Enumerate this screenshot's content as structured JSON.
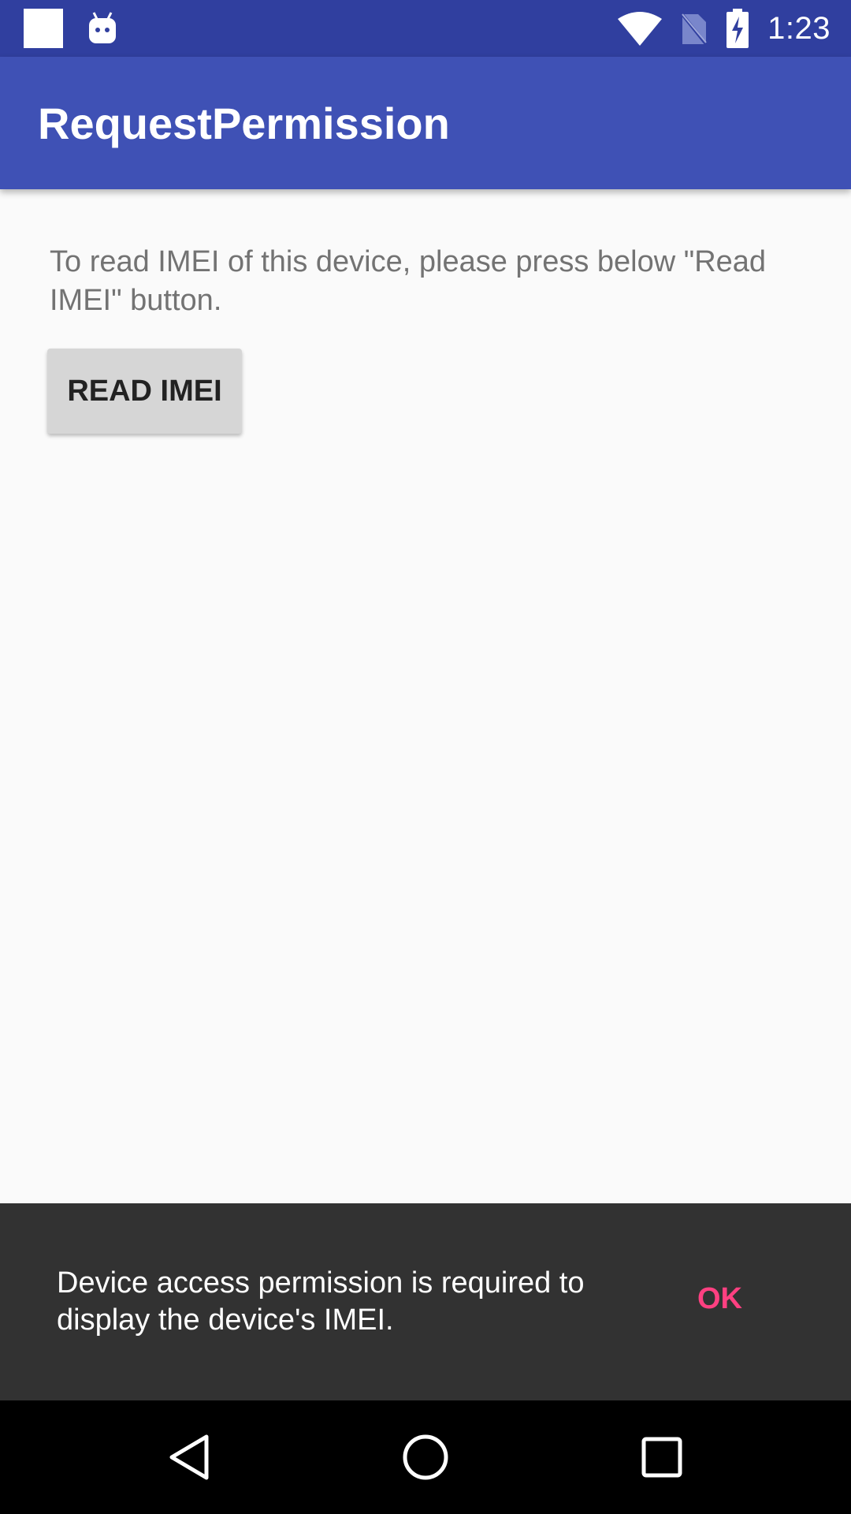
{
  "status_bar": {
    "time": "1:23",
    "icons": [
      "notification-square-icon",
      "android-icon",
      "wifi-icon",
      "no-sim-icon",
      "battery-charging-icon"
    ]
  },
  "app_bar": {
    "title": "RequestPermission"
  },
  "main": {
    "instruction": "To read IMEI of this device, please press below \"Read IMEI\" button.",
    "read_button_label": "READ IMEI"
  },
  "snackbar": {
    "message": "Device access permission is required to display the device's IMEI.",
    "action_label": "OK",
    "action_color": "#ff4081"
  },
  "nav_bar": {
    "buttons": [
      "back-icon",
      "home-icon",
      "recents-icon"
    ]
  },
  "colors": {
    "status_bar": "#303f9f",
    "app_bar": "#3f51b5",
    "snackbar": "#323232"
  }
}
